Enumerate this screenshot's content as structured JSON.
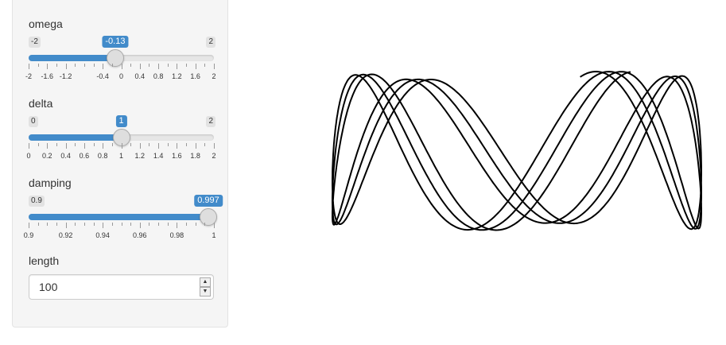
{
  "sidebar": {
    "controls": {
      "omega": {
        "label": "omega",
        "min_label": "-2",
        "max_label": "2",
        "value_label": "-0.13",
        "value": -0.13,
        "min": -2,
        "max": 2,
        "tick_labels": [
          "-2",
          "-1.6",
          "-1.2",
          "-0.4",
          "0",
          "0.4",
          "0.8",
          "1.2",
          "1.6",
          "2"
        ],
        "tick_values": [
          -2,
          -1.6,
          -1.2,
          -0.4,
          0,
          0.4,
          0.8,
          1.2,
          1.6,
          2
        ]
      },
      "delta": {
        "label": "delta",
        "min_label": "0",
        "max_label": "2",
        "value_label": "1",
        "value": 1,
        "min": 0,
        "max": 2,
        "tick_labels": [
          "0",
          "0.2",
          "0.4",
          "0.6",
          "0.8",
          "1",
          "1.2",
          "1.4",
          "1.6",
          "1.8",
          "2"
        ],
        "tick_values": [
          0,
          0.2,
          0.4,
          0.6,
          0.8,
          1,
          1.2,
          1.4,
          1.6,
          1.8,
          2
        ]
      },
      "damping": {
        "label": "damping",
        "min_label": "0.9",
        "max_label": "",
        "value_label": "0.997",
        "value": 0.997,
        "min": 0.9,
        "max": 1,
        "tick_labels": [
          "0.9",
          "0.92",
          "0.94",
          "0.96",
          "0.98",
          "1"
        ],
        "tick_values": [
          0.9,
          0.92,
          0.94,
          0.96,
          0.98,
          1
        ]
      },
      "length": {
        "label": "length",
        "value": "100",
        "spinner_up": "▲",
        "spinner_down": "▼"
      }
    }
  },
  "colors": {
    "accent": "#428bca",
    "curve": "#000000"
  }
}
